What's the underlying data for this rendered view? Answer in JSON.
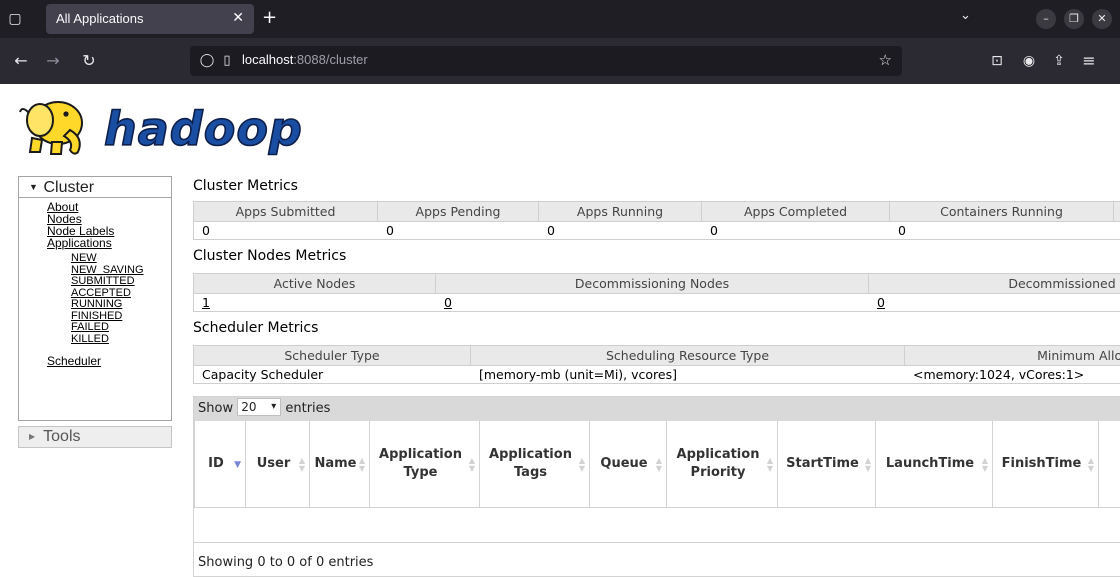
{
  "browser": {
    "tab_title": "All Applications",
    "url_host": "localhost",
    "url_port": ":8088/cluster"
  },
  "logo_text": "hadoop",
  "sidebar": {
    "cluster_label": "Cluster",
    "links": [
      "About",
      "Nodes",
      "Node Labels",
      "Applications"
    ],
    "app_states": [
      "NEW",
      "NEW_SAVING",
      "SUBMITTED",
      "ACCEPTED",
      "RUNNING",
      "FINISHED",
      "FAILED",
      "KILLED"
    ],
    "scheduler_label": "Scheduler",
    "tools_label": "Tools"
  },
  "cluster_metrics": {
    "title": "Cluster Metrics",
    "headers": [
      "Apps Submitted",
      "Apps Pending",
      "Apps Running",
      "Apps Completed",
      "Containers Running"
    ],
    "values": [
      "0",
      "0",
      "0",
      "0",
      "0"
    ]
  },
  "node_metrics": {
    "title": "Cluster Nodes Metrics",
    "headers": [
      "Active Nodes",
      "Decommissioning Nodes",
      "Decommissioned N"
    ],
    "values": [
      "1",
      "0",
      "0"
    ]
  },
  "scheduler_metrics": {
    "title": "Scheduler Metrics",
    "headers": [
      "Scheduler Type",
      "Scheduling Resource Type",
      "Minimum Alloc"
    ],
    "values": [
      "Capacity Scheduler",
      "[memory-mb (unit=Mi), vcores]",
      "<memory:1024, vCores:1>"
    ]
  },
  "apps_table": {
    "show_label": "Show",
    "page_size": "20",
    "entries_label": "entries",
    "columns": [
      "ID",
      "User",
      "Name",
      "Application Type",
      "Application Tags",
      "Queue",
      "Application Priority",
      "StartTime",
      "LaunchTime",
      "FinishTime"
    ],
    "info": "Showing 0 to 0 of 0 entries"
  },
  "colors": {
    "tabbar": "#1f1e25",
    "navbar": "#2b2a33",
    "logo_yellow": "#ffd829",
    "logo_blue": "#1a4ea3"
  }
}
